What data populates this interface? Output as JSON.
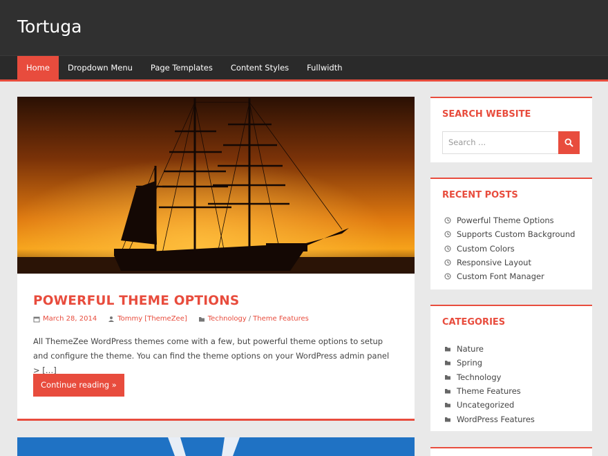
{
  "site": {
    "title": "Tortuga"
  },
  "nav": {
    "items": [
      {
        "label": "Home"
      },
      {
        "label": "Dropdown Menu"
      },
      {
        "label": "Page Templates"
      },
      {
        "label": "Content Styles"
      },
      {
        "label": "Fullwidth"
      }
    ]
  },
  "post": {
    "title": "POWERFUL THEME OPTIONS",
    "date": "March 28, 2014",
    "author": "Tommy [ThemeZee]",
    "category1": "Technology",
    "category_sep": "/",
    "category2": "Theme Features",
    "excerpt": "All ThemeZee WordPress themes come with a few, but powerful theme options to setup and configure the theme. You can find the theme options on your WordPress admin panel > […]",
    "continue_label": "Continue reading »"
  },
  "sidebar": {
    "search": {
      "title": "SEARCH WEBSITE",
      "placeholder": "Search ..."
    },
    "recent": {
      "title": "RECENT POSTS",
      "items": [
        {
          "label": "Powerful Theme Options"
        },
        {
          "label": "Supports Custom Background"
        },
        {
          "label": "Custom Colors"
        },
        {
          "label": "Responsive Layout"
        },
        {
          "label": "Custom Font Manager"
        }
      ]
    },
    "categories": {
      "title": "CATEGORIES",
      "items": [
        {
          "label": "Nature"
        },
        {
          "label": "Spring"
        },
        {
          "label": "Technology"
        },
        {
          "label": "Theme Features"
        },
        {
          "label": "Uncategorized"
        },
        {
          "label": "WordPress Features"
        }
      ]
    }
  },
  "icons": {
    "date": "calendar-icon",
    "author": "user-icon",
    "category": "folder-icon",
    "search": "search-icon",
    "recent": "clock-icon",
    "categories": "folder-icon"
  },
  "colors": {
    "accent": "#e84c3d",
    "header": "#303030",
    "nav": "#2a2a2a",
    "background": "#e9e9e9"
  }
}
